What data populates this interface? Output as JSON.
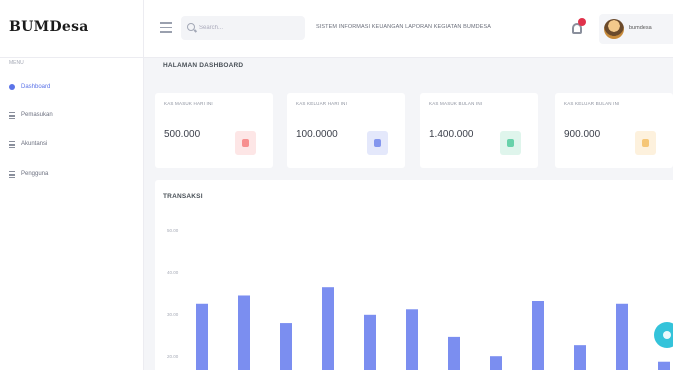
{
  "brand": {
    "name": "BUMDesa"
  },
  "search": {
    "placeholder": "Search..."
  },
  "topbar": {
    "marquee": "SISTEM INFORMASI KEUANGAN LAPORAN KEGIATAN BUMDESA",
    "user_name": "bumdesa"
  },
  "sidebar": {
    "header": "MENU",
    "items": [
      {
        "label": "Dashboard",
        "icon": "dashboard-icon",
        "active": true
      },
      {
        "label": "Pemasukan",
        "icon": "pemasukan-icon",
        "active": false
      },
      {
        "label": "Akuntansi",
        "icon": "akuntansi-icon",
        "active": false
      },
      {
        "label": "Pengguna",
        "icon": "pengguna-icon",
        "active": false
      }
    ]
  },
  "page": {
    "title": "HALAMAN DASHBOARD"
  },
  "stats": [
    {
      "label": "KAS MASUK HARI INI",
      "value": "500.000",
      "accent": "#f46a6a",
      "badge_bg": "#fde6e6"
    },
    {
      "label": "KAS KELUAR HARI INI",
      "value": "100.0000",
      "accent": "#5b73e8",
      "badge_bg": "#e4e8fb"
    },
    {
      "label": "KAS MASUK BULAN INI",
      "value": "1.400.000",
      "accent": "#34c38f",
      "badge_bg": "#dff5ec"
    },
    {
      "label": "KAS KELUAR BULAN INI",
      "value": "900.000",
      "accent": "#f1b44c",
      "badge_bg": "#fdf1dd"
    }
  ],
  "chart_data": {
    "type": "bar",
    "title": "TRANSAKSI",
    "y_ticks": [
      "50.00",
      "40.00",
      "30.00",
      "20.00"
    ],
    "ylim": [
      0,
      50
    ],
    "values": [
      24,
      27,
      17,
      30,
      20,
      22,
      12,
      5,
      25,
      9,
      24,
      3
    ],
    "bar_color": "#7b8ef0"
  },
  "colors": {
    "accent": "#5b73e8",
    "fab": "#34c3da"
  }
}
